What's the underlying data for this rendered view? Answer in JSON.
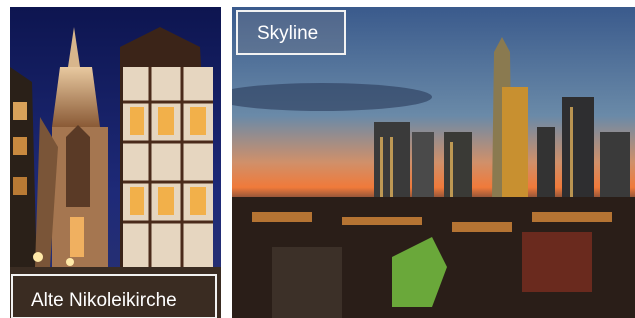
{
  "tiles": [
    {
      "caption": "Alte Nikoleikirche",
      "image": "church-night-photo"
    },
    {
      "caption": "Skyline",
      "image": "city-skyline-dusk-photo"
    }
  ]
}
